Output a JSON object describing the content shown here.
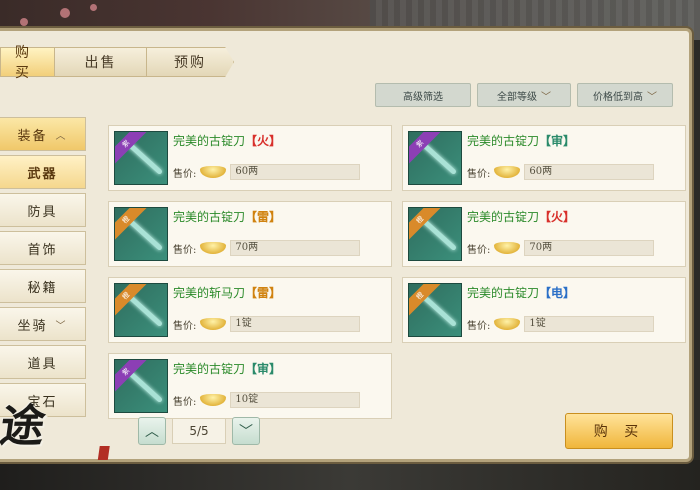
{
  "tabs": [
    {
      "label": "购买"
    },
    {
      "label": "出售"
    },
    {
      "label": "预购"
    }
  ],
  "filters": {
    "advanced": "高级筛选",
    "level": "全部等级",
    "sort": "价格低到高"
  },
  "sidebar": [
    {
      "label": "装备",
      "icon": "chevron-up-icon"
    },
    {
      "label": "武器"
    },
    {
      "label": "防具"
    },
    {
      "label": "首饰"
    },
    {
      "label": "秘籍"
    },
    {
      "label": "坐骑",
      "icon": "chevron-down-icon"
    },
    {
      "label": "道具"
    },
    {
      "label": "宝石"
    }
  ],
  "items": [
    {
      "name": "完美的古锭刀",
      "attr": "【火】",
      "price_label": "售价:",
      "price": "60两",
      "badge": "紫",
      "rarity_color": "#8c3fb5"
    },
    {
      "name": "完美的古锭刀",
      "attr": "【审】",
      "price_label": "售价:",
      "price": "60两",
      "badge": "紫",
      "rarity_color": "#8c3fb5"
    },
    {
      "name": "完美的古锭刀",
      "attr": "【雷】",
      "price_label": "售价:",
      "price": "70两",
      "badge": "橙",
      "rarity_color": "#d98a2a"
    },
    {
      "name": "完美的古锭刀",
      "attr": "【火】",
      "price_label": "售价:",
      "price": "70两",
      "badge": "橙",
      "rarity_color": "#d98a2a"
    },
    {
      "name": "完美的斩马刀",
      "attr": "【雷】",
      "price_label": "售价:",
      "price": "1锭",
      "badge": "橙",
      "rarity_color": "#d98a2a"
    },
    {
      "name": "完美的古锭刀",
      "attr": "【电】",
      "price_label": "售价:",
      "price": "1锭",
      "badge": "橙",
      "rarity_color": "#d98a2a"
    },
    {
      "name": "完美的古锭刀",
      "attr": "【审】",
      "price_label": "售价:",
      "price": "10锭",
      "badge": "紫",
      "rarity_color": "#8c3fb5"
    }
  ],
  "pagination": {
    "page": "5/5"
  },
  "buy_button": "购 买",
  "logo_text": "途"
}
